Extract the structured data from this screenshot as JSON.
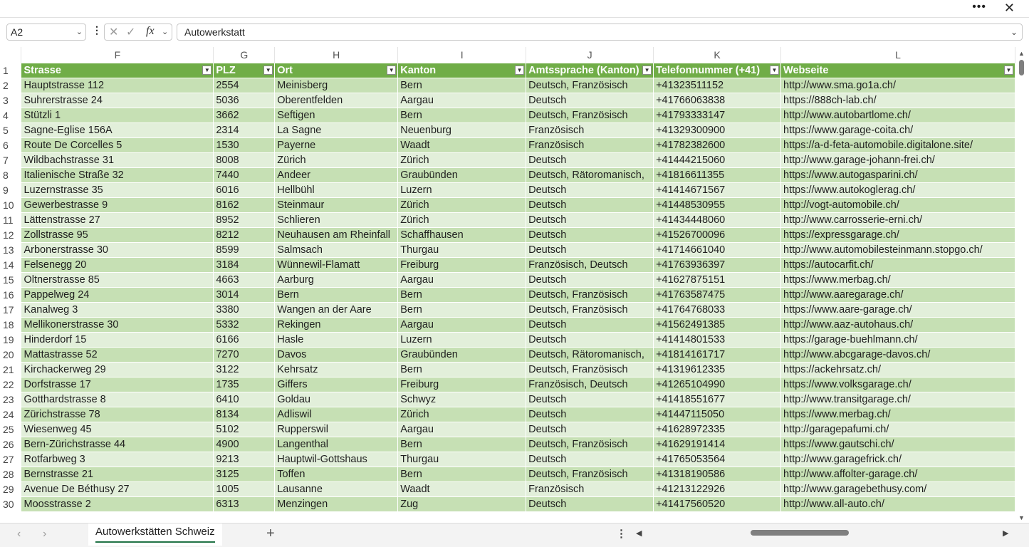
{
  "title_bar": {
    "more_icon": "more-horizontal-icon",
    "close_icon": "close-icon"
  },
  "formula_bar": {
    "name_box": "A2",
    "formula_value": "Autowerkstatt",
    "fx_label": "fx"
  },
  "columns": [
    "F",
    "G",
    "H",
    "I",
    "J",
    "K",
    "L"
  ],
  "headers": [
    "Strasse",
    "PLZ",
    "Ort",
    "Kanton",
    "Amtssprache (Kanton)",
    "Telefonnummer (+41)",
    "Webseite"
  ],
  "rows": [
    {
      "n": "2",
      "c": [
        "Hauptstrasse 112",
        "2554",
        "Meinisberg",
        "Bern",
        "Deutsch, Französisch",
        "+41323511152",
        "http://www.sma.go1a.ch/"
      ]
    },
    {
      "n": "3",
      "c": [
        "Suhrerstrasse 24",
        "5036",
        "Oberentfelden",
        "Aargau",
        "Deutsch",
        "+41766063838",
        "https://888ch-lab.ch/"
      ]
    },
    {
      "n": "4",
      "c": [
        "Stützli 1",
        "3662",
        "Seftigen",
        "Bern",
        "Deutsch, Französisch",
        "+41793333147",
        "http://www.autobartlome.ch/"
      ]
    },
    {
      "n": "5",
      "c": [
        "Sagne-Eglise 156A",
        "2314",
        "La Sagne",
        "Neuenburg",
        "Französisch",
        "+41329300900",
        "https://www.garage-coita.ch/"
      ]
    },
    {
      "n": "6",
      "c": [
        "Route De Corcelles 5",
        "1530",
        "Payerne",
        "Waadt",
        "Französisch",
        "+41782382600",
        "https://a-d-feta-automobile.digitalone.site/"
      ]
    },
    {
      "n": "7",
      "c": [
        "Wildbachstrasse 31",
        "8008",
        "Zürich",
        "Zürich",
        "Deutsch",
        "+41444215060",
        "http://www.garage-johann-frei.ch/"
      ]
    },
    {
      "n": "8",
      "c": [
        "Italienische Straße 32",
        "7440",
        "Andeer",
        "Graubünden",
        "Deutsch, Rätoromanisch,",
        "+41816611355",
        "https://www.autogasparini.ch/"
      ]
    },
    {
      "n": "9",
      "c": [
        "Luzernstrasse 35",
        "6016",
        "Hellbühl",
        "Luzern",
        "Deutsch",
        "+41414671567",
        "https://www.autokoglerag.ch/"
      ]
    },
    {
      "n": "10",
      "c": [
        "Gewerbestrasse 9",
        "8162",
        "Steinmaur",
        "Zürich",
        "Deutsch",
        "+41448530955",
        "http://vogt-automobile.ch/"
      ]
    },
    {
      "n": "11",
      "c": [
        "Lättenstrasse 27",
        "8952",
        "Schlieren",
        "Zürich",
        "Deutsch",
        "+41434448060",
        "http://www.carrosserie-erni.ch/"
      ]
    },
    {
      "n": "12",
      "c": [
        "Zollstrasse 95",
        "8212",
        "Neuhausen am Rheinfall",
        "Schaffhausen",
        "Deutsch",
        "+41526700096",
        "https://expressgarage.ch/"
      ]
    },
    {
      "n": "13",
      "c": [
        "Arbonerstrasse 30",
        "8599",
        "Salmsach",
        "Thurgau",
        "Deutsch",
        "+41714661040",
        "http://www.automobilesteinmann.stopgo.ch/"
      ]
    },
    {
      "n": "14",
      "c": [
        "Felsenegg 20",
        "3184",
        "Wünnewil-Flamatt",
        "Freiburg",
        "Französisch, Deutsch",
        "+41763936397",
        "https://autocarfit.ch/"
      ]
    },
    {
      "n": "15",
      "c": [
        "Oltnerstrasse 85",
        "4663",
        "Aarburg",
        "Aargau",
        "Deutsch",
        "+41627875151",
        "https://www.merbag.ch/"
      ]
    },
    {
      "n": "16",
      "c": [
        "Pappelweg 24",
        "3014",
        "Bern",
        "Bern",
        "Deutsch, Französisch",
        "+41763587475",
        "http://www.aaregarage.ch/"
      ]
    },
    {
      "n": "17",
      "c": [
        "Kanalweg 3",
        "3380",
        "Wangen an der Aare",
        "Bern",
        "Deutsch, Französisch",
        "+41764768033",
        "https://www.aare-garage.ch/"
      ]
    },
    {
      "n": "18",
      "c": [
        "Mellikonerstrasse 30",
        "5332",
        "Rekingen",
        "Aargau",
        "Deutsch",
        "+41562491385",
        "http://www.aaz-autohaus.ch/"
      ]
    },
    {
      "n": "19",
      "c": [
        "Hinderdorf 15",
        "6166",
        "Hasle",
        "Luzern",
        "Deutsch",
        "+41414801533",
        "https://garage-buehlmann.ch/"
      ]
    },
    {
      "n": "20",
      "c": [
        "Mattastrasse 52",
        "7270",
        "Davos",
        "Graubünden",
        "Deutsch, Rätoromanisch,",
        "+41814161717",
        "http://www.abcgarage-davos.ch/"
      ]
    },
    {
      "n": "21",
      "c": [
        "Kirchackerweg 29",
        "3122",
        "Kehrsatz",
        "Bern",
        "Deutsch, Französisch",
        "+41319612335",
        "https://ackehrsatz.ch/"
      ]
    },
    {
      "n": "22",
      "c": [
        "Dorfstrasse 17",
        "1735",
        "Giffers",
        "Freiburg",
        "Französisch, Deutsch",
        "+41265104990",
        "https://www.volksgarage.ch/"
      ]
    },
    {
      "n": "23",
      "c": [
        "Gotthardstrasse 8",
        "6410",
        "Goldau",
        "Schwyz",
        "Deutsch",
        "+41418551677",
        "http://www.transitgarage.ch/"
      ]
    },
    {
      "n": "24",
      "c": [
        "Zürichstrasse 78",
        "8134",
        "Adliswil",
        "Zürich",
        "Deutsch",
        "+41447115050",
        "https://www.merbag.ch/"
      ]
    },
    {
      "n": "25",
      "c": [
        "Wiesenweg 45",
        "5102",
        "Rupperswil",
        "Aargau",
        "Deutsch",
        "+41628972335",
        "http://garagepafumi.ch/"
      ]
    },
    {
      "n": "26",
      "c": [
        "Bern-Zürichstrasse 44",
        "4900",
        "Langenthal",
        "Bern",
        "Deutsch, Französisch",
        "+41629191414",
        "https://www.gautschi.ch/"
      ]
    },
    {
      "n": "27",
      "c": [
        "Rotfarbweg 3",
        "9213",
        "Hauptwil-Gottshaus",
        "Thurgau",
        "Deutsch",
        "+41765053564",
        "http://www.garagefrick.ch/"
      ]
    },
    {
      "n": "28",
      "c": [
        "Bernstrasse 21",
        "3125",
        "Toffen",
        "Bern",
        "Deutsch, Französisch",
        "+41318190586",
        "http://www.affolter-garage.ch/"
      ]
    },
    {
      "n": "29",
      "c": [
        "Avenue De Béthusy 27",
        "1005",
        "Lausanne",
        "Waadt",
        "Französisch",
        "+41213122926",
        "http://www.garagebethusy.com/"
      ]
    },
    {
      "n": "30",
      "c": [
        "Moosstrasse 2",
        "6313",
        "Menzingen",
        "Zug",
        "Deutsch",
        "+41417560520",
        "http://www.all-auto.ch/"
      ]
    }
  ],
  "sheet_tabs": {
    "active": "Autowerkstätten Schweiz"
  },
  "colors": {
    "header_green": "#70ad47",
    "band_dark": "#c6e0b4",
    "band_light": "#e2efda",
    "tab_underline": "#217346"
  }
}
